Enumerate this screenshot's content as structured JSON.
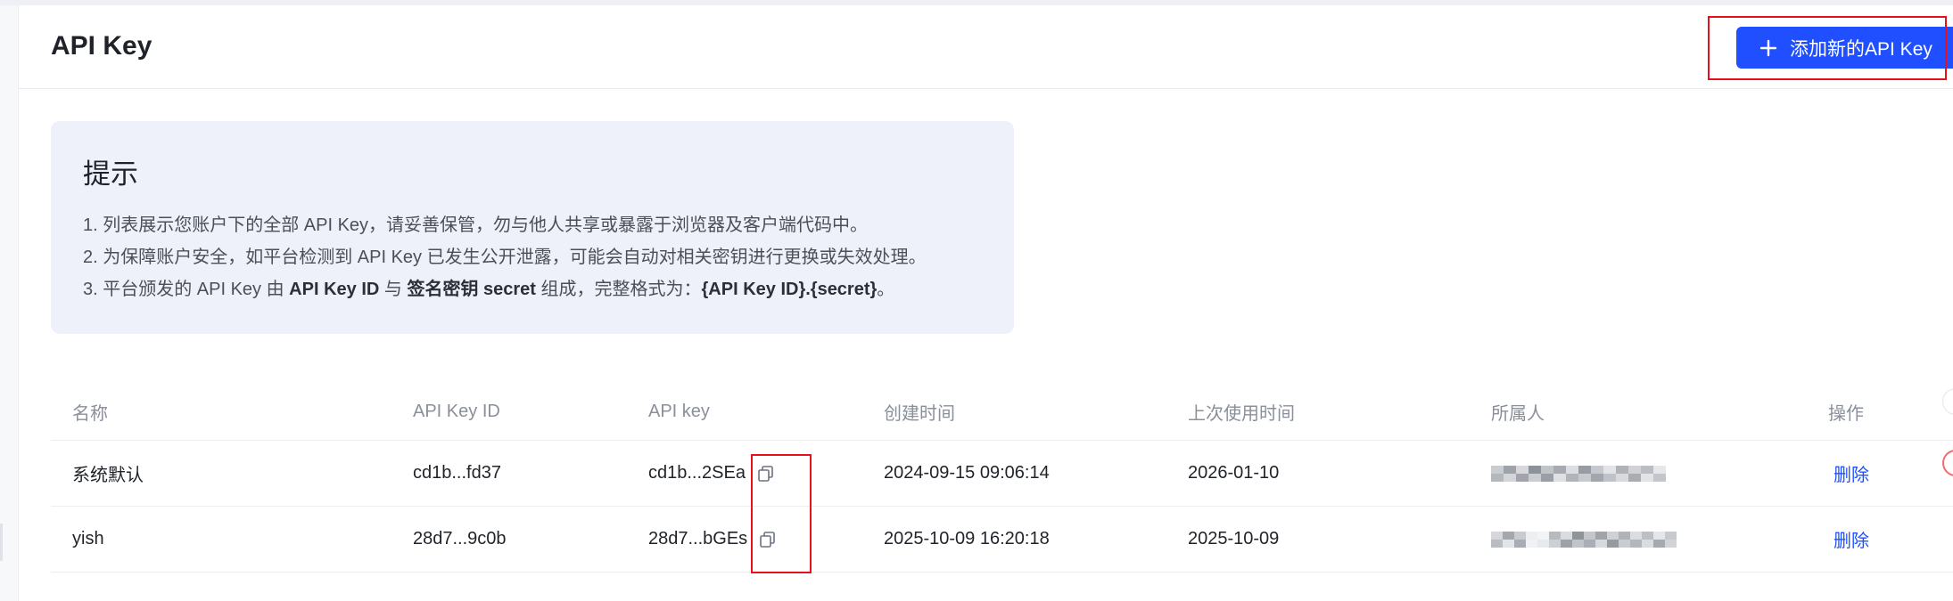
{
  "header": {
    "title": "API Key",
    "add_button_label": "添加新的API Key"
  },
  "tip": {
    "title": "提示",
    "line1": "1. 列表展示您账户下的全部 API Key，请妥善保管，勿与他人共享或暴露于浏览器及客户端代码中。",
    "line2": "2. 为保障账户安全，如平台检测到 API Key 已发生公开泄露，可能会自动对相关密钥进行更换或失效处理。",
    "line3_prefix": "3. 平台颁发的 API Key 由 ",
    "line3_bold1": "API Key ID",
    "line3_mid1": " 与 ",
    "line3_bold2": "签名密钥 secret",
    "line3_mid2": " 组成，完整格式为：",
    "line3_bold3": "{API Key ID}.{secret}",
    "line3_suffix": "。"
  },
  "table": {
    "columns": [
      "名称",
      "API Key ID",
      "API key",
      "创建时间",
      "上次使用时间",
      "所属人",
      "操作"
    ],
    "rows": [
      {
        "name": "系统默认",
        "key_id": "cd1b...fd37",
        "api_key": "cd1b...2SEa",
        "created": "2024-09-15 09:06:14",
        "last_used": "2026-01-10",
        "action": "删除"
      },
      {
        "name": "yish",
        "key_id": "28d7...9c0b",
        "api_key": "28d7...bGEs",
        "created": "2025-10-09 16:20:18",
        "last_used": "2025-10-09",
        "action": "删除"
      }
    ]
  },
  "colors": {
    "accent": "#1f4fff",
    "highlight": "#e8101b",
    "tip_background": "#eef1f9"
  },
  "icons": [
    "plus-icon",
    "copy-icon"
  ]
}
